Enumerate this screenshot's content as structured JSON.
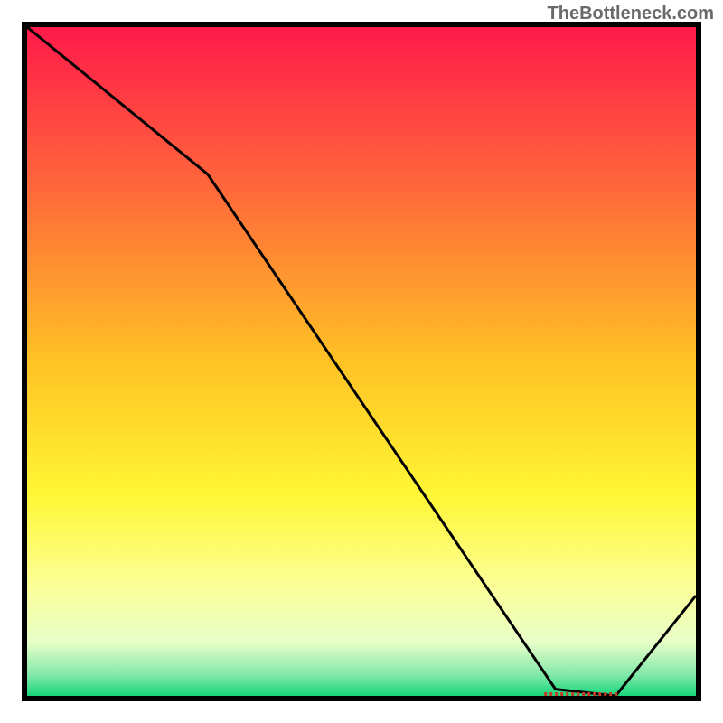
{
  "watermark": "TheBottleneck.com",
  "chart_data": {
    "type": "line",
    "title": "",
    "xlabel": "",
    "ylabel": "",
    "x": [
      0,
      27,
      79,
      88,
      100
    ],
    "values": [
      100,
      78,
      1,
      0,
      15
    ],
    "xlim": [
      0,
      100
    ],
    "ylim": [
      0,
      100
    ],
    "grid": false,
    "background_gradient": {
      "stops": [
        {
          "pos": 0.0,
          "color": "#ff1a4a"
        },
        {
          "pos": 0.25,
          "color": "#ff6b3a"
        },
        {
          "pos": 0.5,
          "color": "#ffc224"
        },
        {
          "pos": 0.7,
          "color": "#fff735"
        },
        {
          "pos": 0.84,
          "color": "#fcff9a"
        },
        {
          "pos": 0.92,
          "color": "#e8ffc8"
        },
        {
          "pos": 0.97,
          "color": "#7ee8a8"
        },
        {
          "pos": 1.0,
          "color": "#16d67a"
        }
      ]
    },
    "marker": {
      "x": 83,
      "y": 0,
      "label_visible": true
    }
  }
}
